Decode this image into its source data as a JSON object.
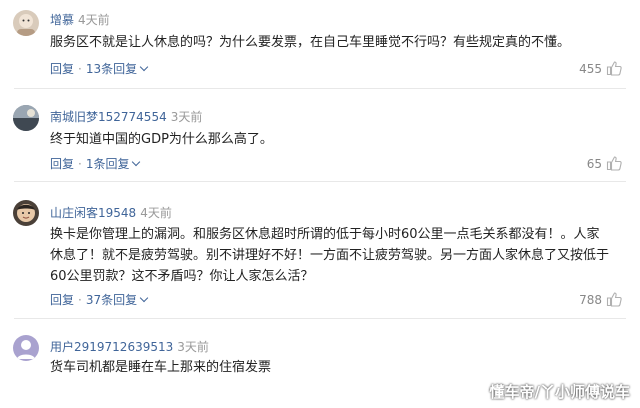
{
  "comments": [
    {
      "username": "增慕",
      "time": "4天前",
      "text": "服务区不就是让人休息的吗？为什么要发票，在自己车里睡觉不行吗？有些规定真的不懂。",
      "reply_label": "回复",
      "replies_label": "13条回复",
      "likes": "455",
      "avatar_color": "#c9b8a6"
    },
    {
      "username": "南城旧梦152774554",
      "time": "3天前",
      "text": "终于知道中国的GDP为什么那么高了。",
      "reply_label": "回复",
      "replies_label": "1条回复",
      "likes": "65",
      "avatar_color": "#6f7a86"
    },
    {
      "username": "山庄闲客19548",
      "time": "4天前",
      "text": "换卡是你管理上的漏洞。和服务区休息超时所谓的低于每小时60公里一点毛关系都没有！。人家休息了！就不是疲劳驾驶。别不讲理好不好！一方面不让疲劳驾驶。另一方面人家休息了又按低于60公里罚款？这不矛盾吗？你让人家怎么活？",
      "reply_label": "回复",
      "replies_label": "37条回复",
      "likes": "788",
      "avatar_color": "#4a4038"
    },
    {
      "username": "用户2919712639513",
      "time": "3天前",
      "text": "货车司机都是睡在车上那来的住宿发票",
      "avatar_color": "#8a7fb8"
    }
  ],
  "watermark": "懂车帝/丫小师傅说车",
  "icons": {
    "like": "thumbs-up-icon",
    "expand": "chevron-down-icon"
  }
}
